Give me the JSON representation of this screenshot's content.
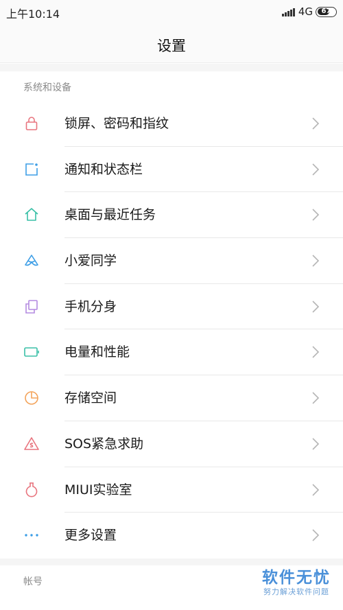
{
  "status_bar": {
    "time": "上午10:14",
    "network": "4G",
    "battery": "67",
    "battery_level": 0.67,
    "signal_bars": 4
  },
  "header": {
    "title": "设置"
  },
  "sections": [
    {
      "label": "系统和设备",
      "items": [
        {
          "label": "锁屏、密码和指纹",
          "icon": "lock-icon",
          "color": "#e8747e"
        },
        {
          "label": "通知和状态栏",
          "icon": "notification-icon",
          "color": "#3d9ee6"
        },
        {
          "label": "桌面与最近任务",
          "icon": "home-icon",
          "color": "#38bfa6"
        },
        {
          "label": "小爱同学",
          "icon": "xiaoai-icon",
          "color": "#3d9ee6"
        },
        {
          "label": "手机分身",
          "icon": "dual-phone-icon",
          "color": "#b48ae0"
        },
        {
          "label": "电量和性能",
          "icon": "battery-icon",
          "color": "#38bfa6"
        },
        {
          "label": "存储空间",
          "icon": "storage-icon",
          "color": "#f3a35a"
        },
        {
          "label": "SOS紧急求助",
          "icon": "sos-icon",
          "color": "#e8747e"
        },
        {
          "label": "MIUI实验室",
          "icon": "flask-icon",
          "color": "#e8747e"
        },
        {
          "label": "更多设置",
          "icon": "more-icon",
          "color": "#3d9ee6"
        }
      ]
    },
    {
      "label": "帐号",
      "items": []
    }
  ],
  "watermark": {
    "title": "软件无忧",
    "subtitle": "努力解决软件问题"
  }
}
